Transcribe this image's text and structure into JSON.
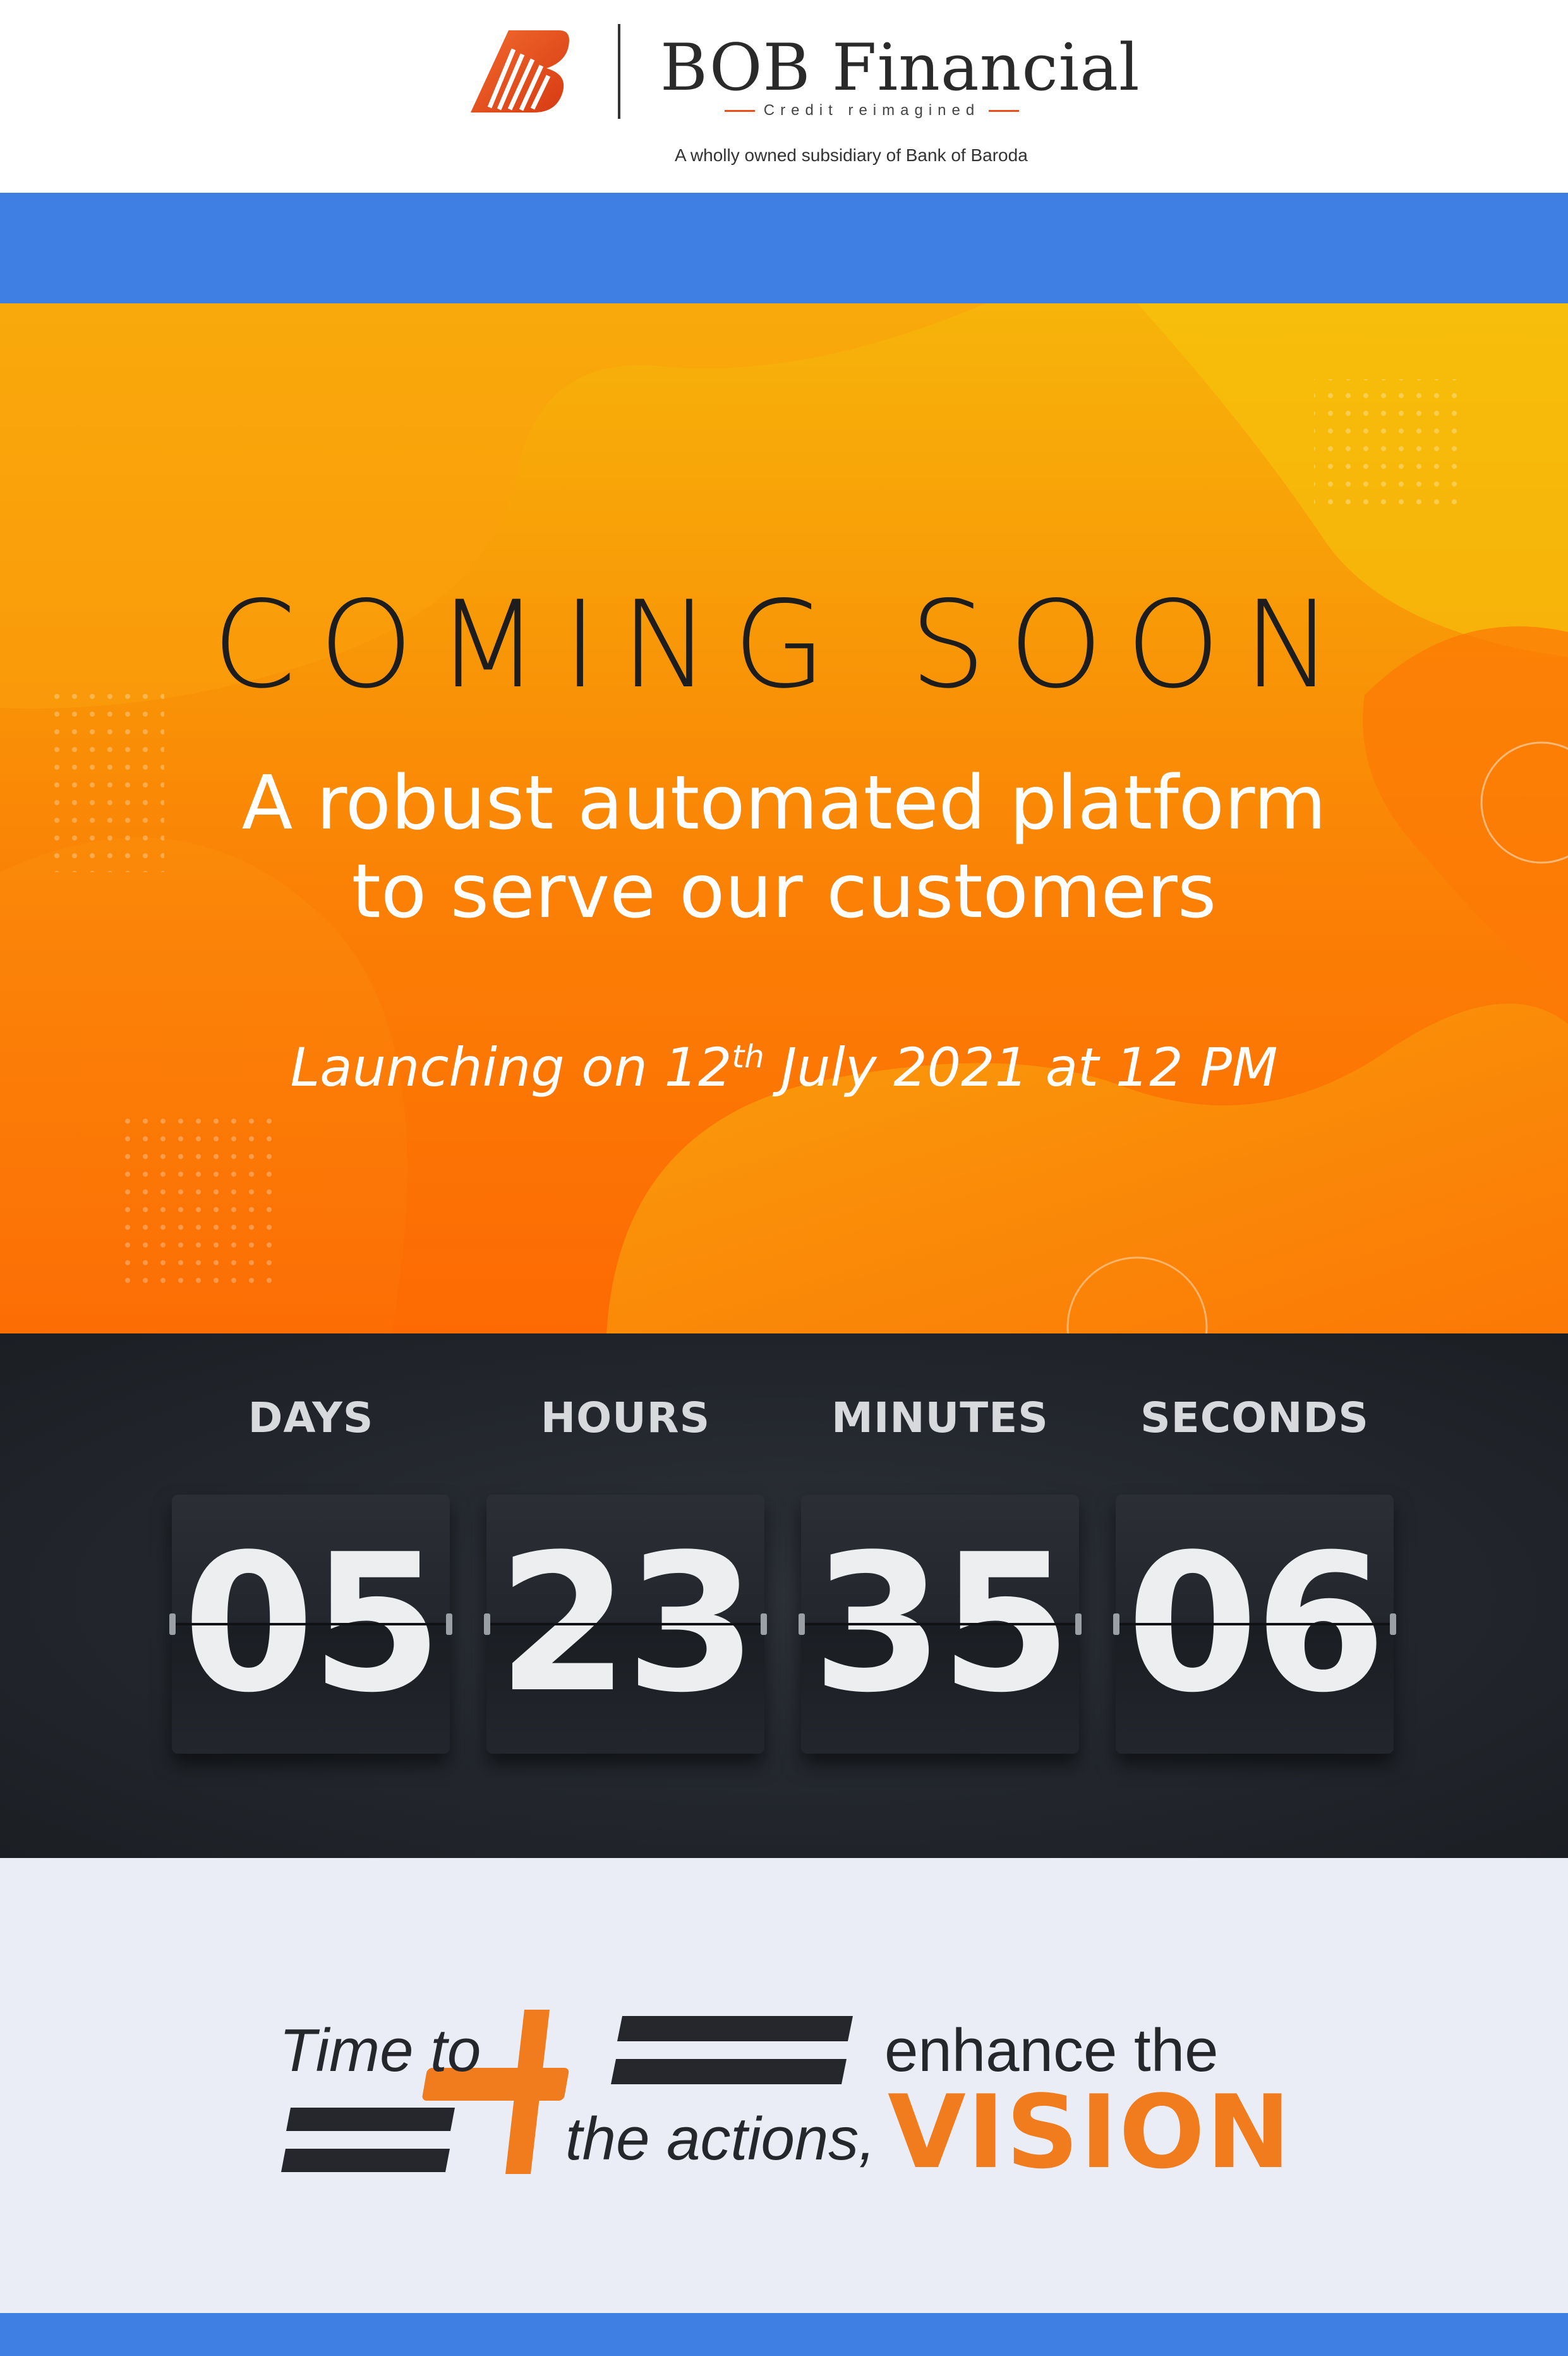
{
  "header": {
    "brand_name": "BOB Financial",
    "brand_tagline": "Credit reimagined",
    "subsidiary_text": "A wholly owned subsidiary of Bank of Baroda"
  },
  "hero": {
    "coming_soon": "COMING SOON",
    "headline_line1": "A robust automated platform",
    "headline_line2": "to serve our customers",
    "launch_prefix": "Launching on 12",
    "launch_superscript": "th",
    "launch_suffix": " July 2021 at 12 PM"
  },
  "countdown": {
    "units": [
      {
        "label": "DAYS",
        "value": "05"
      },
      {
        "label": "HOURS",
        "value": "23"
      },
      {
        "label": "MINUTES",
        "value": "35"
      },
      {
        "label": "SECONDS",
        "value": "06"
      }
    ]
  },
  "tagline": {
    "part1": "Time to",
    "part2": "enhance the",
    "part3": "the actions,",
    "part4": "VISION"
  },
  "colors": {
    "brand_orange": "#e84f1c",
    "band_blue": "#3f7ee3",
    "vision_orange": "#f07c1d",
    "dark_text": "#25272c"
  },
  "icons": {
    "logo": "bank-of-baroda-logo-icon",
    "plus": "plus-icon",
    "equals": "equals-icon",
    "minus": "minus-icon"
  }
}
